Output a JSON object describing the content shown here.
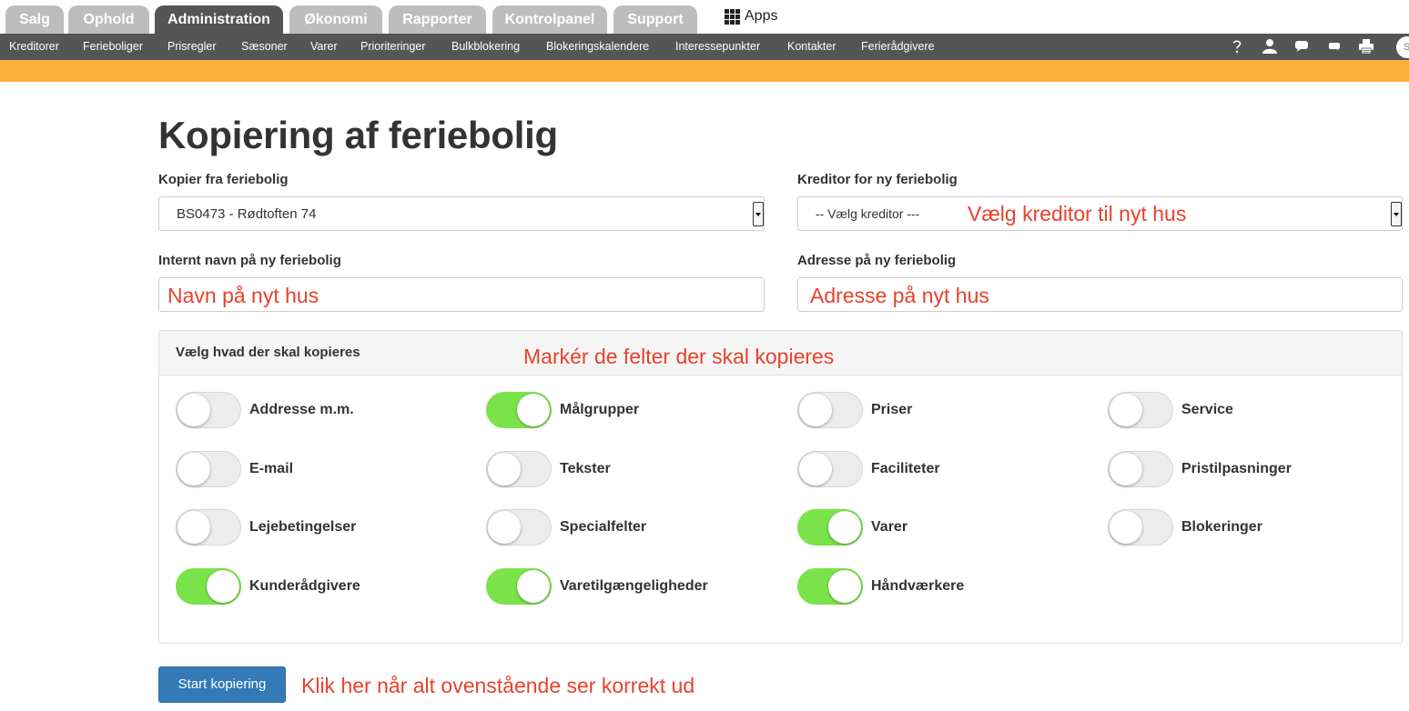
{
  "top_tabs": [
    {
      "label": "Salg",
      "active": false
    },
    {
      "label": "Ophold",
      "active": false
    },
    {
      "label": "Administration",
      "active": true
    },
    {
      "label": "Økonomi",
      "active": false
    },
    {
      "label": "Rapporter",
      "active": false
    },
    {
      "label": "Kontrolpanel",
      "active": false
    },
    {
      "label": "Support",
      "active": false
    }
  ],
  "apps_label": "Apps",
  "subnav": [
    "Kreditorer",
    "Ferieboliger",
    "Prisregler",
    "Sæsoner",
    "Varer",
    "Prioriteringer",
    "Bulkblokering",
    "Blokeringskalendere",
    "Interessepunkter",
    "Kontakter",
    "Ferierådgivere"
  ],
  "subnav_icons": [
    "help-icon",
    "user-icon",
    "chat-icon",
    "message-icon",
    "printer-icon"
  ],
  "search_placeholder": "S",
  "accent_color": "#fbb03b",
  "page_title": "Kopiering af feriebolig",
  "form": {
    "copy_from_label": "Kopier fra feriebolig",
    "copy_from_value": "BS0473 - Rødtoften 74",
    "creditor_label": "Kreditor for ny feriebolig",
    "creditor_value": "-- Vælg kreditor ---",
    "internal_name_label": "Internt navn på ny feriebolig",
    "address_label": "Adresse på ny feriebolig"
  },
  "annotations": {
    "creditor": "Vælg kreditor til nyt hus",
    "name": "Navn på nyt hus",
    "address": "Adresse på nyt hus",
    "fields": "Markér de felter der skal kopieres",
    "start": "Klik her når alt ovenstående ser korrekt ud"
  },
  "panel_title": "Vælg hvad der skal kopieres",
  "toggles": [
    {
      "label": "Addresse m.m.",
      "on": false
    },
    {
      "label": "Målgrupper",
      "on": true
    },
    {
      "label": "Priser",
      "on": false
    },
    {
      "label": "Service",
      "on": false
    },
    {
      "label": "E-mail",
      "on": false
    },
    {
      "label": "Tekster",
      "on": false
    },
    {
      "label": "Faciliteter",
      "on": false
    },
    {
      "label": "Pristilpasninger",
      "on": false
    },
    {
      "label": "Lejebetingelser",
      "on": false
    },
    {
      "label": "Specialfelter",
      "on": false
    },
    {
      "label": "Varer",
      "on": true
    },
    {
      "label": "Blokeringer",
      "on": false
    },
    {
      "label": "Kunderådgivere",
      "on": true
    },
    {
      "label": "Varetilgængeligheder",
      "on": true
    },
    {
      "label": "Håndværkere",
      "on": true
    }
  ],
  "start_button": "Start kopiering"
}
